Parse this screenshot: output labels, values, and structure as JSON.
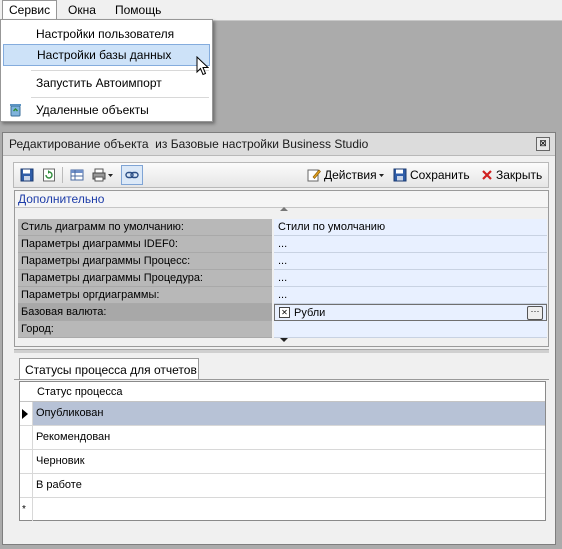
{
  "menubar": {
    "items": [
      {
        "label": "Сервис"
      },
      {
        "label": "Окна"
      },
      {
        "label": "Помощь"
      }
    ]
  },
  "service_menu": {
    "items": [
      {
        "label": "Настройки пользователя"
      },
      {
        "label": "Настройки базы данных"
      },
      {
        "label": "Запустить Автоимпорт"
      },
      {
        "label": "Удаленные объекты",
        "icon": "recycle-bin-icon"
      }
    ]
  },
  "window": {
    "title": "Редактирование объекта  из Базовые настройки Business Studio",
    "close_glyph": "⊠"
  },
  "toolbar": {
    "actions_label": "Действия",
    "save_label": "Сохранить",
    "close_label": "Закрыть",
    "icons": [
      "save-icon",
      "refresh-icon",
      "table-icon",
      "print-icon",
      "link-icon"
    ]
  },
  "property_grid": {
    "category": "Дополнительно",
    "rows": [
      {
        "name": "Стиль диаграмм по умолчанию:",
        "value": "Стили по умолчанию"
      },
      {
        "name": "Параметры диаграммы IDEF0:",
        "value": "..."
      },
      {
        "name": "Параметры диаграммы Процесс:",
        "value": "..."
      },
      {
        "name": "Параметры диаграммы Процедура:",
        "value": "..."
      },
      {
        "name": "Параметры оргдиаграммы:",
        "value": "..."
      },
      {
        "name": "Базовая валюта:",
        "value": "Рубли",
        "checked": true
      },
      {
        "name": "Город:",
        "value": ""
      }
    ]
  },
  "tabs": [
    {
      "label": "Статусы процесса для отчетов"
    }
  ],
  "status_table": {
    "header": "Статус процесса",
    "rows": [
      "Опубликован",
      "Рекомендован",
      "Черновик",
      "В работе"
    ],
    "selected_index": 0,
    "new_row_marker": "*"
  }
}
